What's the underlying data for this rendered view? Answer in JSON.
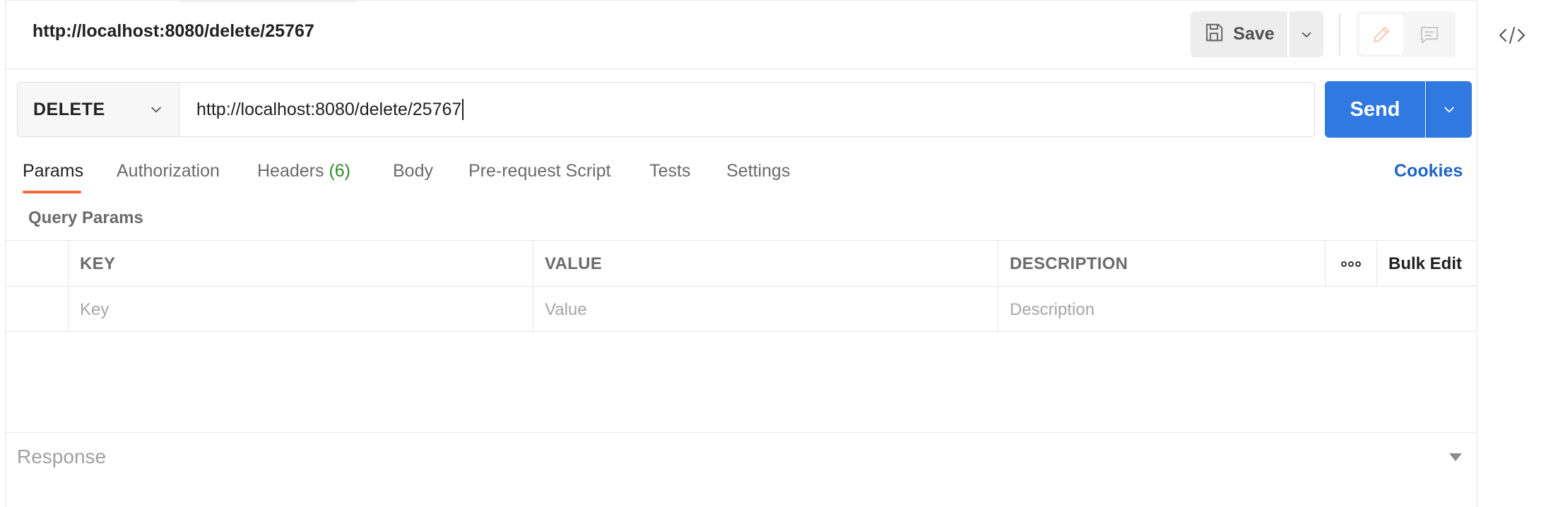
{
  "request": {
    "title": "http://localhost:8080/delete/25767",
    "method": "DELETE",
    "url": "http://localhost:8080/delete/25767"
  },
  "toolbar": {
    "save_label": "Save"
  },
  "send_label": "Send",
  "tabs": [
    {
      "label": "Params",
      "active": true
    },
    {
      "label": "Authorization"
    },
    {
      "label": "Headers",
      "count": "(6)"
    },
    {
      "label": "Body"
    },
    {
      "label": "Pre-request Script"
    },
    {
      "label": "Tests"
    },
    {
      "label": "Settings"
    }
  ],
  "cookies_label": "Cookies",
  "query_params": {
    "label": "Query Params",
    "columns": [
      "KEY",
      "VALUE",
      "DESCRIPTION"
    ],
    "bulk_edit": "Bulk Edit",
    "placeholders": {
      "key": "Key",
      "value": "Value",
      "description": "Description"
    }
  },
  "response": {
    "label": "Response"
  },
  "icons": {
    "save": "floppy-disk-icon",
    "edit": "pencil-icon",
    "comment": "comment-icon",
    "code": "code-icon",
    "more": "more-dots-icon"
  },
  "colors": {
    "accent_blue": "#2f79e1",
    "tab_active_underline": "#f26b3a",
    "link_blue": "#1f63c4",
    "count_green": "#2e8b2e"
  }
}
